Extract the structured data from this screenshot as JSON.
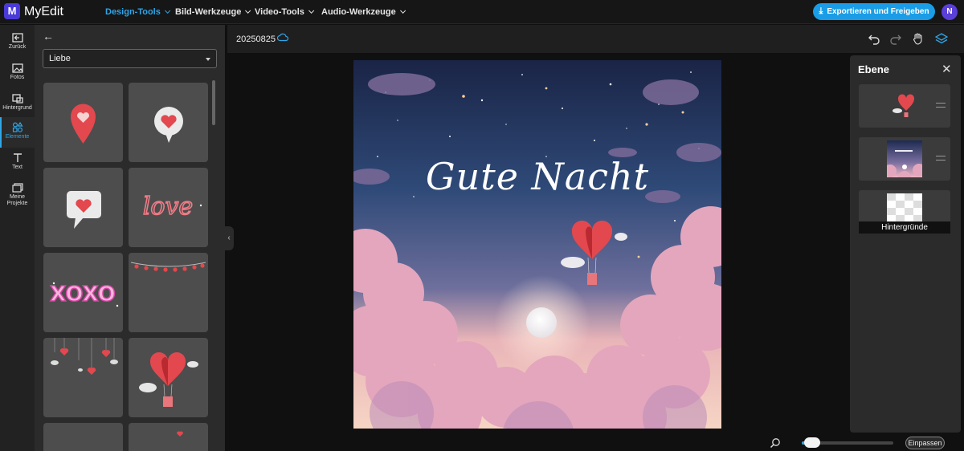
{
  "app": {
    "logo_letter": "M",
    "name": "MyEdit"
  },
  "nav": {
    "menus": [
      {
        "label": "Design-Tools",
        "active": true
      },
      {
        "label": "Bild-Werkzeuge",
        "active": false
      },
      {
        "label": "Video-Tools",
        "active": false
      },
      {
        "label": "Audio-Werkzeuge",
        "active": false
      }
    ],
    "export_label": "Exportieren und Freigeben",
    "avatar_initial": "N"
  },
  "rail": {
    "items": [
      {
        "label": "Zurück",
        "icon": "back-box-icon"
      },
      {
        "label": "Fotos",
        "icon": "image-icon"
      },
      {
        "label": "Hintergrund",
        "icon": "background-icon"
      },
      {
        "label": "Elemente",
        "icon": "elements-icon",
        "active": true
      },
      {
        "label": "Text",
        "icon": "text-icon"
      },
      {
        "label": "Meine Projekte",
        "icon": "folder-icon"
      }
    ]
  },
  "elements_panel": {
    "category": "Liebe",
    "tiles": [
      "heart-pin",
      "heart-bubble",
      "heart-speech-bubble",
      "love-lettering",
      "heart-garland",
      "xoxo-lettering",
      "hanging-hearts",
      "heart-hot-air-balloon"
    ]
  },
  "workspace": {
    "project_name": "20250825",
    "canvas_title": "Gute Nacht"
  },
  "layers_panel": {
    "title": "Ebene",
    "layers": [
      {
        "name": "heart-balloon-layer"
      },
      {
        "name": "background-image-layer"
      },
      {
        "name": "backgrounds-layer",
        "label": "Hintergründe"
      }
    ]
  },
  "zoom": {
    "level": 0.1,
    "fit_label": "Einpassen"
  },
  "colors": {
    "accent": "#2fa6e8",
    "brand": "#4a3bd8",
    "panel": "#2b2b2b"
  }
}
